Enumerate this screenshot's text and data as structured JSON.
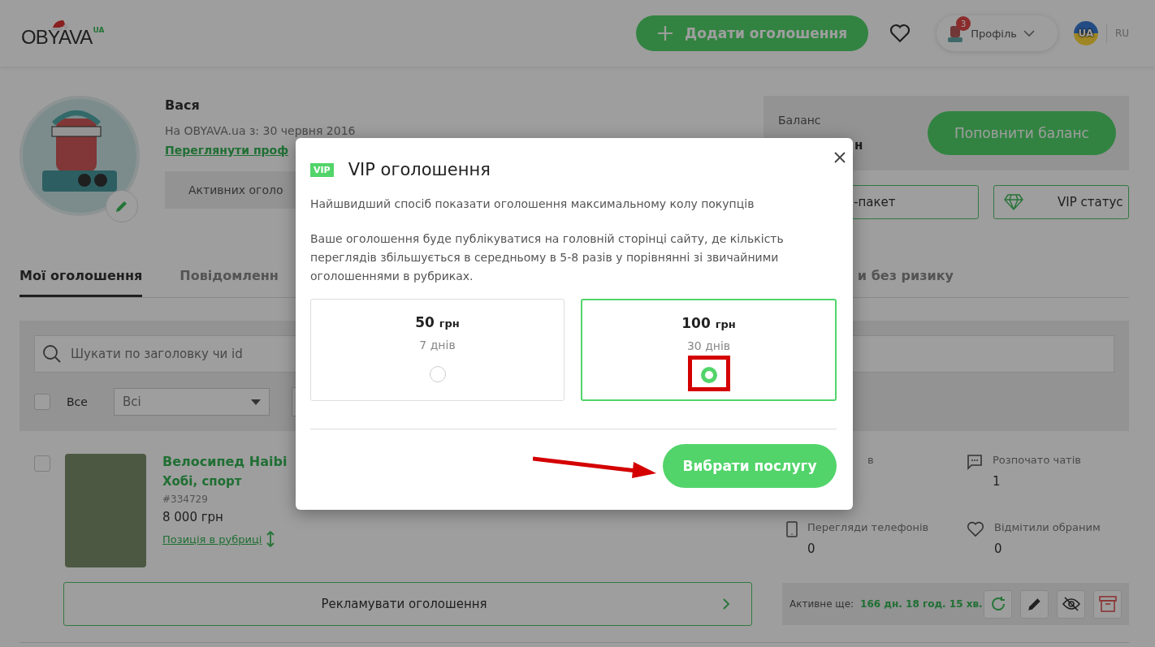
{
  "header": {
    "logo": {
      "text": "OBYAVA",
      "suffix": "UA"
    },
    "add_button": "Додати оголошення",
    "profile": {
      "label": "Профіль",
      "badge": "3"
    },
    "languages": [
      {
        "label": "UA",
        "selected": true
      },
      {
        "label": "RU",
        "selected": false
      }
    ]
  },
  "profile": {
    "name": "Вася",
    "since": "На OBYAVA.ua з: 30 червня 2016",
    "link": "Переглянути проф",
    "active_ads": "Активних оголо"
  },
  "balance": {
    "label": "Баланс",
    "value": "н",
    "button": "Поповнити баланс"
  },
  "service_buttons": [
    {
      "label": "-пакет",
      "kind": "package"
    },
    {
      "label": "VIP статус",
      "kind": "vip"
    }
  ],
  "tabs": [
    {
      "label": "Мої оголошення",
      "selected": true
    },
    {
      "label": "Повідомленн",
      "selected": false
    },
    {
      "label": "и без ризику",
      "selected": false
    }
  ],
  "filters": {
    "search_placeholder": "Шукати по заголовку чи id",
    "select_all": {
      "label": "Все",
      "checked": false
    },
    "status_select": "Всі"
  },
  "listing": {
    "checked": false,
    "title": "Велосипед Haibi",
    "category": "Хобі, спорт",
    "id": "#334729",
    "price": "8 000 грн",
    "position_link": "Позиція в рубриці",
    "stats": [
      {
        "kind": "views",
        "label": "в"
      },
      {
        "kind": "chats",
        "label": "Розпочато чатів",
        "value": "1"
      },
      {
        "kind": "phone",
        "label": "Перегляди телефонів",
        "value": "0"
      },
      {
        "kind": "favorites",
        "label": "Відмітили обраним",
        "value": "0"
      }
    ],
    "promote_button": "Рекламувати оголошення",
    "active_label": "Активне ще:",
    "active_time": "166 дн. 18 год. 15 хв."
  },
  "modal": {
    "badge": "VIP",
    "title": "VIP оголошення",
    "subtitle": "Найшвидший спосіб показати оголошення максимальному колу покупців",
    "description": "Ваше оголошення буде публікуватися на головній сторінці сайту, де кількість переглядів збільшується в середньому в 5-8 разів у порівнянні зі звичайними оголошеннями в рубриках.",
    "options": [
      {
        "price": "50",
        "unit": "грн",
        "duration": "7 днів",
        "selected": false
      },
      {
        "price": "100",
        "unit": "грн",
        "duration": "30 днів",
        "selected": true
      }
    ],
    "submit": "Вибрати послугу"
  }
}
